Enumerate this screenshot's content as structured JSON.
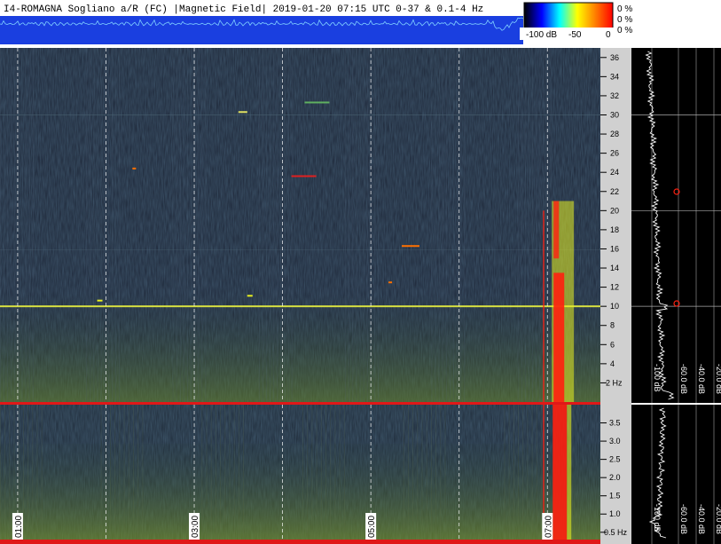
{
  "header": {
    "title": "I4-ROMAGNA  Sogliano a/R (FC) |Magnetic Field| 2019-01-20 07:15 UTC 0-37 & 0.1-4 Hz"
  },
  "colorbar": {
    "labels": [
      "-100 dB",
      "-50",
      "0"
    ],
    "percent_labels": [
      "0 %",
      "0 %",
      "0 %"
    ],
    "colors": [
      "#000000",
      "#0000ff",
      "#00ffff",
      "#ffff00",
      "#ff8000",
      "#ff0000"
    ]
  },
  "colors": {
    "spectrogram_bg": "#1c2536",
    "harmonic_line": "#d8e040",
    "event_red": "#ff2010",
    "event_yellow": "#e8f020",
    "profile_line": "#ffffff",
    "separator": "#e01818",
    "waveform": "#1f7bff"
  },
  "chart_data": [
    {
      "type": "heatmap",
      "panel": "upper",
      "ylabel": "Hz",
      "ylim": [
        0,
        37
      ],
      "yticks": [
        2,
        4,
        6,
        8,
        10,
        12,
        14,
        16,
        18,
        20,
        22,
        24,
        26,
        28,
        30,
        32,
        34,
        36
      ],
      "ytick_labels": [
        "2 Hz",
        "4",
        "6",
        "8",
        "10",
        "12",
        "14",
        "16",
        "18",
        "20",
        "22",
        "24",
        "26",
        "28",
        "30",
        "32",
        "34",
        "36"
      ],
      "xlim_hours": [
        0.8,
        7.6
      ],
      "vgrid_hours": [
        1.0,
        2.0,
        3.0,
        4.0,
        5.0,
        6.0,
        7.0
      ],
      "features": [
        {
          "name": "steady line",
          "y": 10.0,
          "x_range": [
            0.8,
            7.6
          ]
        },
        {
          "name": "broadband burst",
          "x_range": [
            7.05,
            7.3
          ],
          "y_range": [
            0,
            21
          ]
        }
      ],
      "profile_xticks": [
        "-100 dB",
        "-60.0 dB",
        "-40.0 dB",
        "-20.0 dB"
      ]
    },
    {
      "type": "heatmap",
      "panel": "lower",
      "ylabel": "Hz",
      "ylim": [
        0.3,
        4.0
      ],
      "yticks": [
        0.5,
        1.0,
        1.5,
        2.0,
        2.5,
        3.0,
        3.5
      ],
      "ytick_labels": [
        "0.5 Hz",
        "1.0",
        "1.5",
        "2.0",
        "2.5",
        "3.0",
        "3.5"
      ],
      "xlim_hours": [
        0.8,
        7.6
      ],
      "time_labels": [
        "01:00",
        "03:00",
        "05:00",
        "07:00"
      ],
      "time_label_hours": [
        1.0,
        3.0,
        5.0,
        7.0
      ],
      "profile_xticks": [
        "-100 dB",
        "-60.0 dB",
        "-40.0 dB",
        "-20.0 dB"
      ]
    }
  ]
}
